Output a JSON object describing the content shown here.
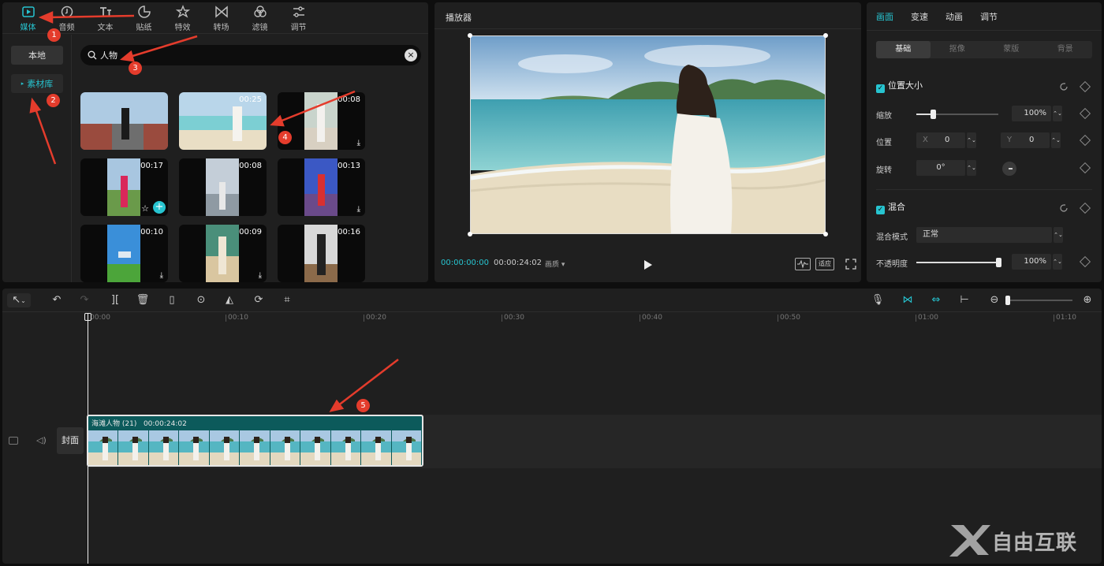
{
  "media_panel": {
    "tabs": [
      {
        "label": "媒体",
        "icon": "media-icon",
        "active": true
      },
      {
        "label": "音频",
        "icon": "audio-icon"
      },
      {
        "label": "文本",
        "icon": "text-icon"
      },
      {
        "label": "贴纸",
        "icon": "sticker-icon"
      },
      {
        "label": "特效",
        "icon": "effects-icon"
      },
      {
        "label": "转场",
        "icon": "transition-icon"
      },
      {
        "label": "滤镜",
        "icon": "filter-icon"
      },
      {
        "label": "调节",
        "icon": "adjust-icon"
      }
    ],
    "side": {
      "local": "本地",
      "library": "素材库"
    },
    "search": {
      "value": "人物"
    },
    "thumbs": [
      {
        "duration": "",
        "download": false
      },
      {
        "duration": "00:25",
        "download": false
      },
      {
        "duration": "00:08",
        "download": true
      },
      {
        "duration": "00:17",
        "download": false,
        "favorite": true,
        "add": true
      },
      {
        "duration": "00:08",
        "download": false
      },
      {
        "duration": "00:13",
        "download": true
      },
      {
        "duration": "00:10",
        "download": true
      },
      {
        "duration": "00:09",
        "download": true
      },
      {
        "duration": "00:16",
        "download": false
      }
    ]
  },
  "player": {
    "title": "播放器",
    "current_time": "00:00:00:00",
    "total_time": "00:00:24:02",
    "ratio_label": "画质",
    "fit_label": "适应"
  },
  "properties": {
    "tabs": [
      "画面",
      "变速",
      "动画",
      "调节"
    ],
    "active_tab": "画面",
    "segments": [
      "基础",
      "抠像",
      "蒙版",
      "背景"
    ],
    "section_position": "位置大小",
    "scale_label": "缩放",
    "scale_value": "100%",
    "scale_level": 0.2,
    "position_label": "位置",
    "x_label": "X",
    "x_value": "0",
    "y_label": "Y",
    "y_value": "0",
    "rotate_label": "旋转",
    "rotate_value": "0°",
    "section_blend": "混合",
    "blend_mode_label": "混合模式",
    "blend_mode_value": "正常",
    "opacity_label": "不透明度",
    "opacity_value": "100%",
    "opacity_level": 1.0
  },
  "timeline": {
    "ruler": [
      "00:00",
      "00:10",
      "00:20",
      "00:30",
      "00:40",
      "00:50",
      "01:00",
      "01:10"
    ],
    "clip_name": "海滩人物 (21)",
    "clip_duration": "00:00:24:02",
    "cover_label": "封面"
  },
  "annotations": [
    "1",
    "2",
    "3",
    "4",
    "5"
  ],
  "watermark": "自由互联",
  "colors": {
    "accent": "#27c4d0",
    "annotation": "#e43c2c",
    "clip": "#0c5a5b"
  }
}
